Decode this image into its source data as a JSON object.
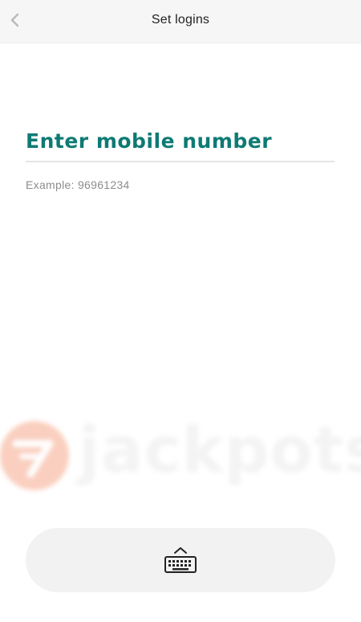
{
  "header": {
    "title": "Set logins",
    "back_icon": "chevron-left-icon"
  },
  "form": {
    "mobile_placeholder": "Enter mobile number",
    "mobile_value": "",
    "hint": "Example: 96961234"
  },
  "watermark": {
    "text": "jackpots"
  },
  "keyboard_toggle": {
    "icon": "keyboard-icon"
  },
  "colors": {
    "accent": "#0e7a74",
    "header_bg": "#f6f6f6",
    "hint": "#8c8c8c",
    "toggle_bg": "#f2f2f2",
    "watermark_logo": "#f6a98c"
  }
}
